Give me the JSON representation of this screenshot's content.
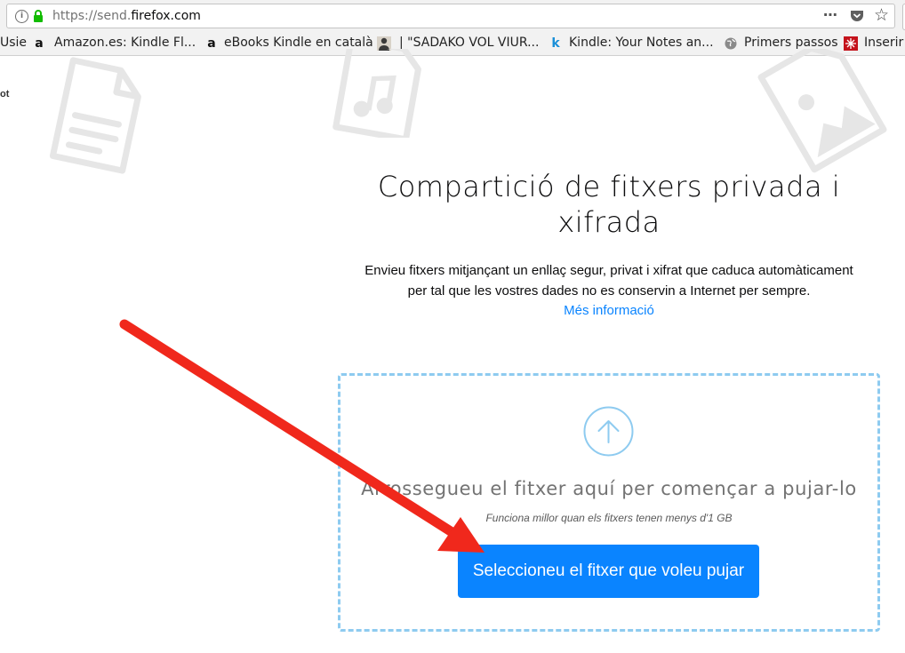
{
  "browser": {
    "url_prefix": "https://send.",
    "url_host": "firefox.com",
    "page_actions_icon": "⋯",
    "bookmark_star_icon": "☆",
    "bookmarks": [
      {
        "icon": "",
        "label": "Usie"
      },
      {
        "icon": "a",
        "label": "Amazon.es: Kindle Fl..."
      },
      {
        "icon": "a",
        "label": "eBooks Kindle en català"
      },
      {
        "icon": "person",
        "label": "| \"SADAKO VOL VIUR..."
      },
      {
        "icon": "k",
        "label": "Kindle: Your Notes an..."
      },
      {
        "icon": "globe",
        "label": "Primers passos"
      },
      {
        "icon": "red-square",
        "label": "Inserir"
      }
    ]
  },
  "page": {
    "side_fragment": "ot",
    "title_line1": "Compartició de fitxers privada i",
    "title_line2": "xifrada",
    "description_line1": "Envieu fitxers mitjançant un enllaç segur, privat i xifrat que caduca automàticament",
    "description_line2": "per tal que les vostres dades no es conservin a Internet per sempre.",
    "more_info_link": "Més informació",
    "dropzone": {
      "drop_text": "Arrossegueu el fitxer aquí per començar a pujar-lo",
      "hint": "Funciona millor quan els fitxers tenen menys d'1 GB",
      "select_button": "Seleccioneu el fitxer que voleu pujar"
    }
  },
  "colors": {
    "accent": "#0a84ff",
    "dropzone_border": "#8ecbf0",
    "annotation_arrow": "#f0281c"
  }
}
